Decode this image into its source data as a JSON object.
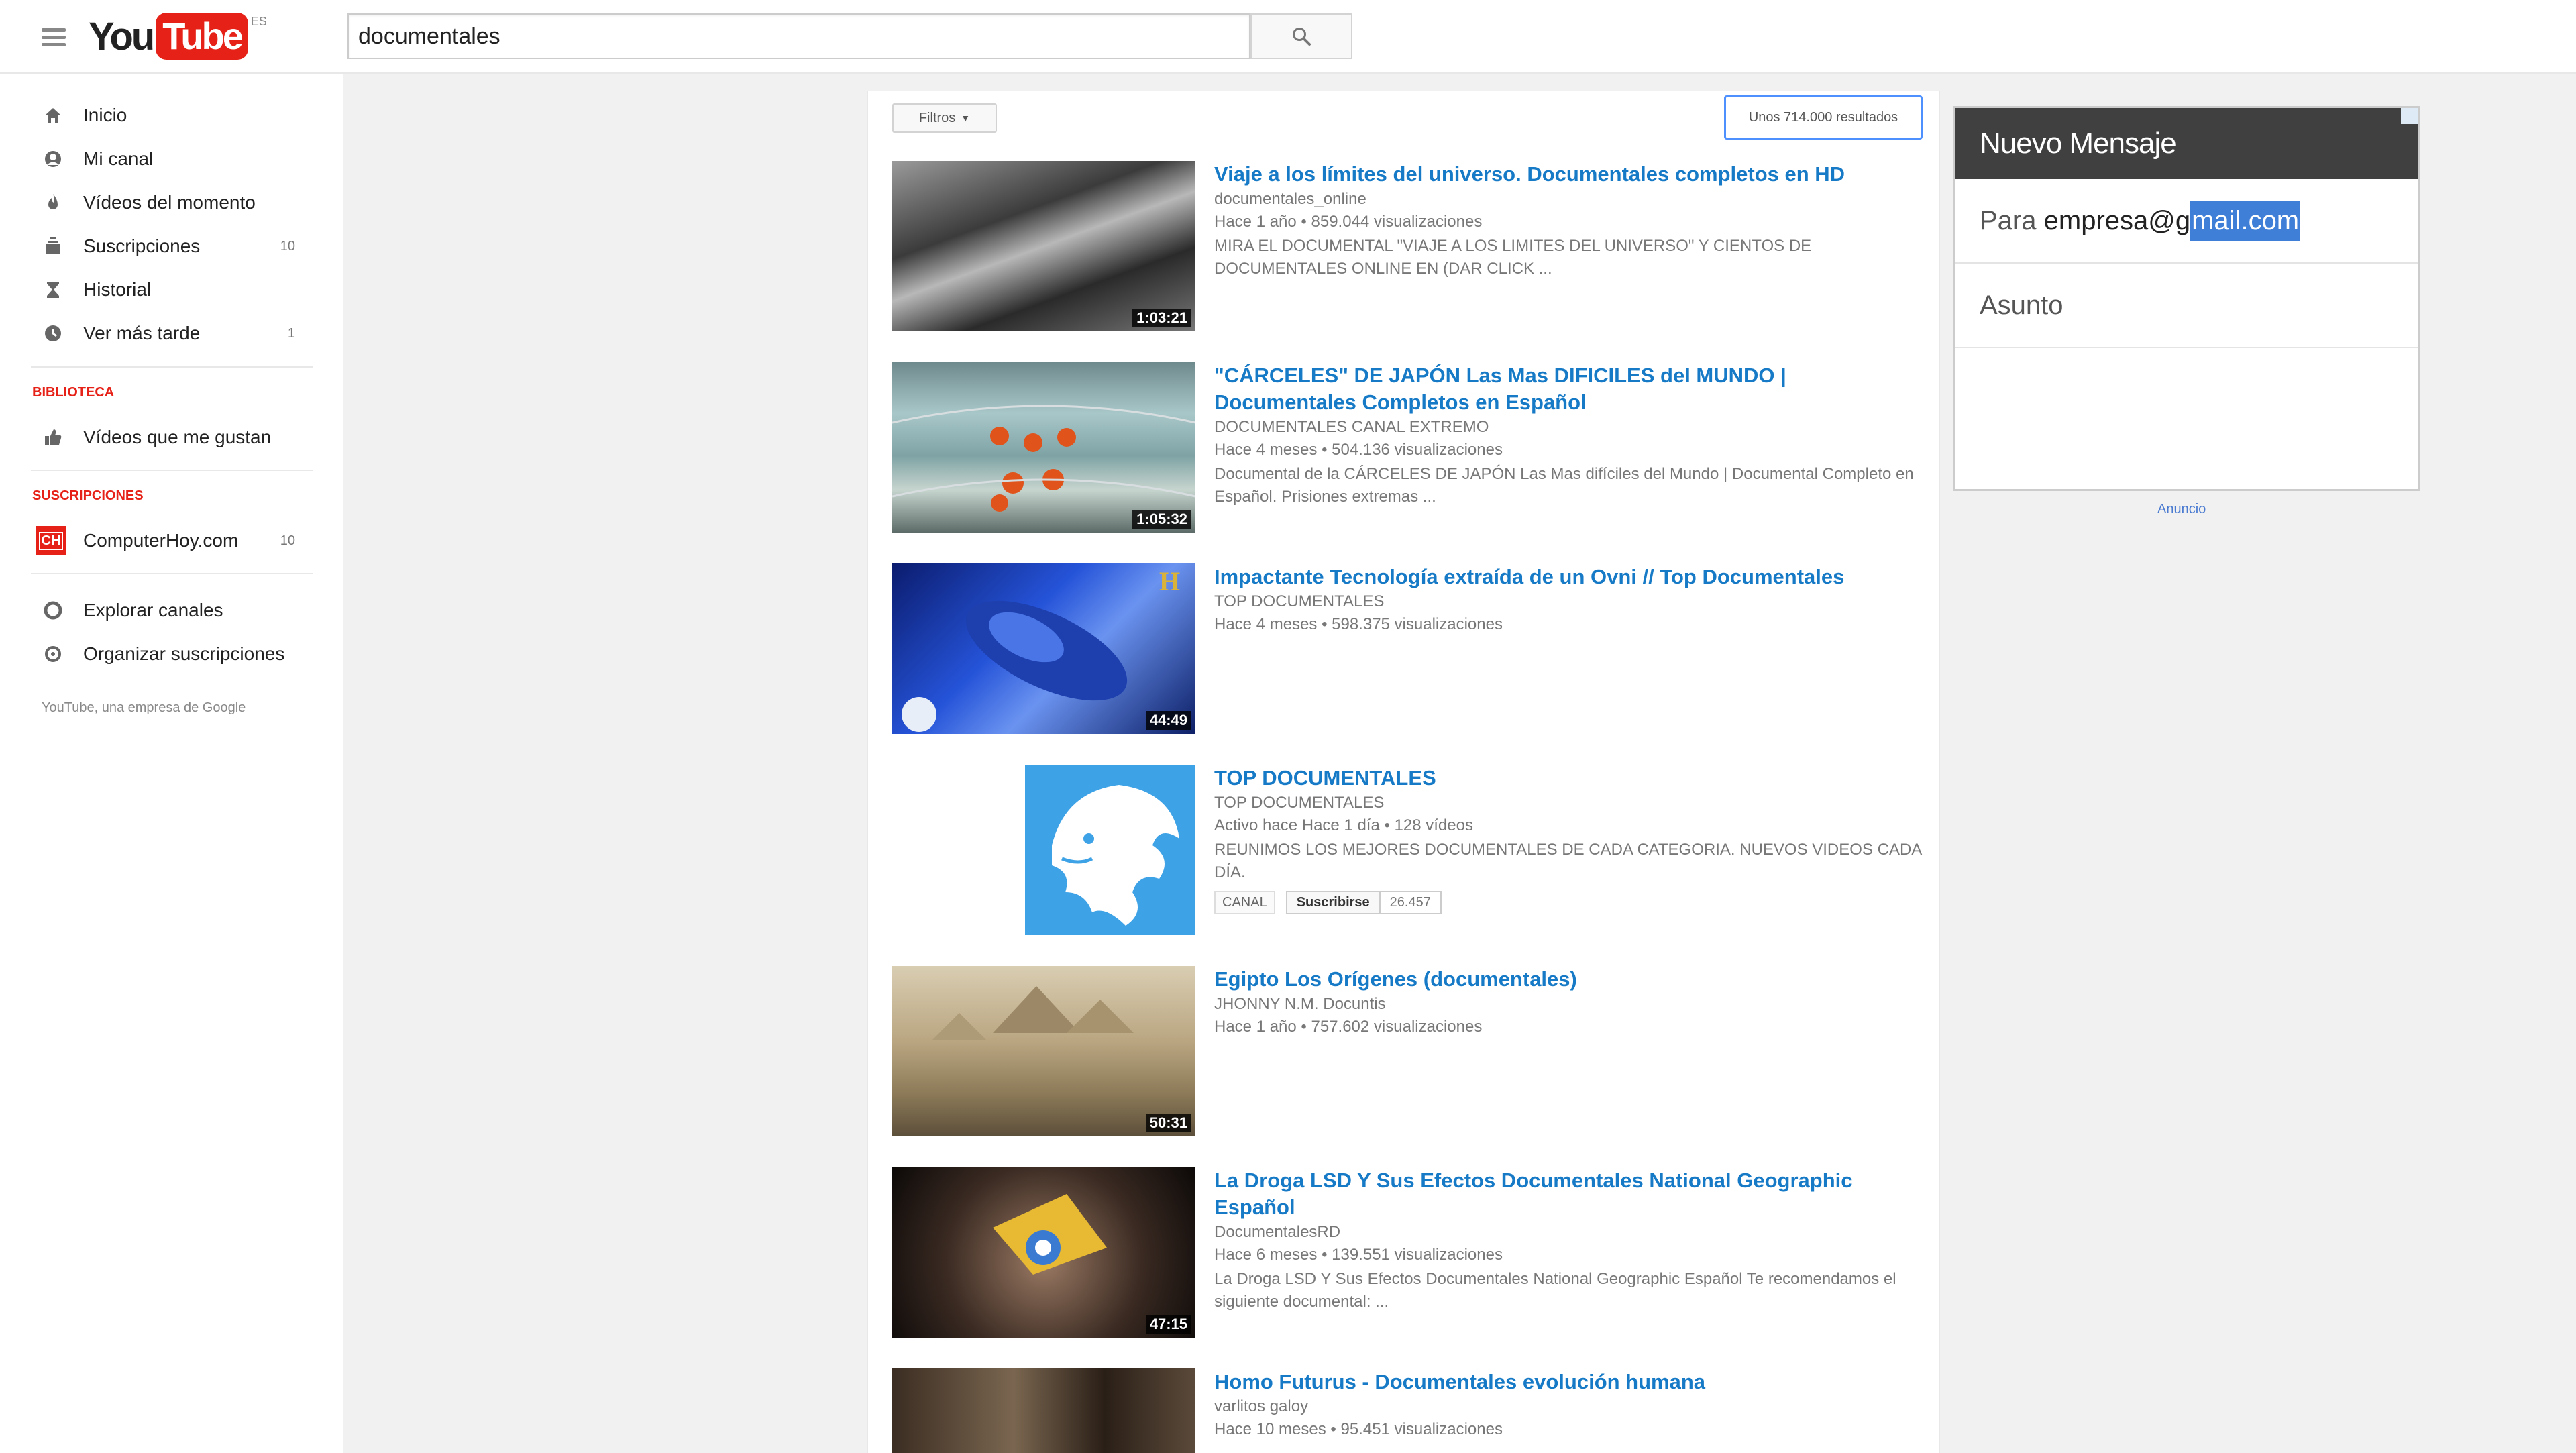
{
  "header": {
    "logo_you": "You",
    "logo_tube": "Tube",
    "logo_region": "ES",
    "search_query": "documentales"
  },
  "sidebar": {
    "items": [
      {
        "label": "Inicio",
        "icon": "home-icon",
        "count": ""
      },
      {
        "label": "Mi canal",
        "icon": "my-channel-icon",
        "count": ""
      },
      {
        "label": "Vídeos del momento",
        "icon": "trending-icon",
        "count": ""
      },
      {
        "label": "Suscripciones",
        "icon": "subscriptions-icon",
        "count": "10"
      },
      {
        "label": "Historial",
        "icon": "history-icon",
        "count": ""
      },
      {
        "label": "Ver más tarde",
        "icon": "watch-later-icon",
        "count": "1"
      }
    ],
    "library_heading": "BIBLIOTECA",
    "library_items": [
      {
        "label": "Vídeos que me gustan",
        "icon": "thumbs-up-icon"
      }
    ],
    "subscriptions_heading": "SUSCRIPCIONES",
    "subscriptions": [
      {
        "label": "ComputerHoy.com",
        "count": "10",
        "avatar": "CH"
      }
    ],
    "bottom_items": [
      {
        "label": "Explorar canales",
        "icon": "explore-icon"
      },
      {
        "label": "Organizar suscripciones",
        "icon": "manage-icon"
      }
    ],
    "footer": "YouTube, una empresa de Google"
  },
  "results_bar": {
    "filters_label": "Filtros",
    "count_label": "Unos 714.000 resultados"
  },
  "results": [
    {
      "title": "Viaje a los límites del universo. Documentales completos en HD",
      "channel": "documentales_online",
      "meta": "Hace 1 año • 859.044 visualizaciones",
      "description": "MIRA EL DOCUMENTAL \"VIAJE A LOS LIMITES DEL UNIVERSO\" Y CIENTOS DE DOCUMENTALES ONLINE EN (DAR CLICK ...",
      "duration": "1:03:21"
    },
    {
      "title": "\"CÁRCELES\" DE JAPÓN Las Mas DIFICILES del MUNDO | Documentales Completos en Español",
      "channel": "DOCUMENTALES CANAL EXTREMO",
      "meta": "Hace 4 meses • 504.136 visualizaciones",
      "description": "Documental de la CÁRCELES DE JAPÓN Las Mas difíciles del Mundo | Documental Completo en Español. Prisiones extremas ...",
      "duration": "1:05:32"
    },
    {
      "title": "Impactante Tecnología extraída de un Ovni // Top Documentales",
      "channel": "TOP DOCUMENTALES",
      "meta": "Hace 4 meses • 598.375 visualizaciones",
      "description": "",
      "duration": "44:49"
    },
    {
      "title": "TOP DOCUMENTALES",
      "channel": "TOP DOCUMENTALES",
      "meta": "Activo hace Hace 1 día • 128 vídeos",
      "description": "REUNIMOS LOS MEJORES DOCUMENTALES DE CADA CATEGORIA. NUEVOS VIDEOS CADA DÍA.",
      "chip": "CANAL",
      "subscribe_label": "Suscribirse",
      "subscriber_count": "26.457"
    },
    {
      "title": "Egipto Los Orígenes (documentales)",
      "channel": "JHONNY N.M. Docuntis",
      "meta": "Hace 1 año • 757.602 visualizaciones",
      "description": "",
      "duration": "50:31"
    },
    {
      "title": "La Droga LSD Y Sus Efectos Documentales National Geographic Español",
      "channel": "DocumentalesRD",
      "meta": "Hace 6 meses • 139.551 visualizaciones",
      "description": "La Droga LSD Y Sus Efectos Documentales National Geographic Español Te recomendamos el siguiente documental: ...",
      "duration": "47:15"
    },
    {
      "title": "Homo Futurus - Documentales evolución humana",
      "channel": "varlitos galoy",
      "meta": "Hace 10 meses • 95.451 visualizaciones",
      "description": "",
      "duration": ""
    }
  ],
  "ad": {
    "heading": "Nuevo Mensaje",
    "to_label": "Para",
    "to_value_plain": "empresa@g",
    "to_value_selected": "mail.com",
    "subject_label": "Asunto",
    "ad_label": "Anuncio"
  }
}
